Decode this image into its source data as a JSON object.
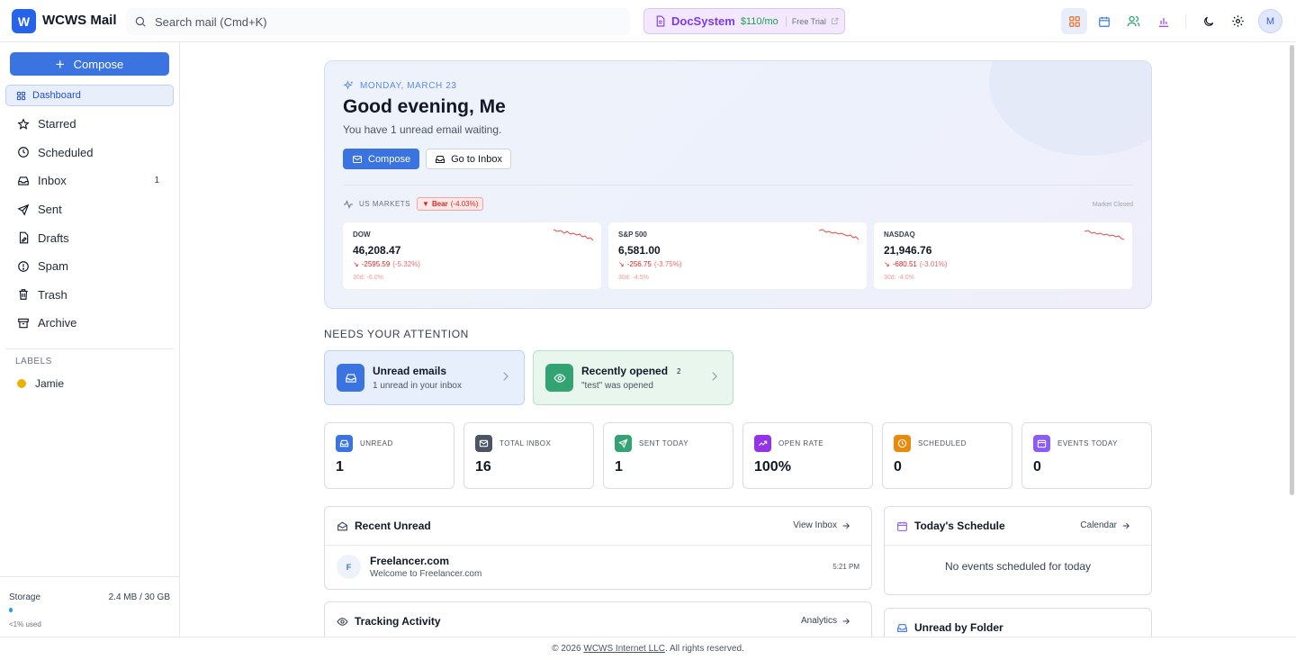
{
  "app": {
    "logo_letter": "W",
    "title": "WCWS Mail"
  },
  "search": {
    "placeholder": "Search mail (Cmd+K)"
  },
  "promo": {
    "name": "DocSystem",
    "price": "$110/mo",
    "trial": "Free Trial"
  },
  "user": {
    "initial": "M"
  },
  "sidebar": {
    "compose_label": "Compose",
    "items": [
      {
        "label": "Dashboard",
        "icon": "grid-icon",
        "active": true
      },
      {
        "label": "Starred",
        "icon": "star-icon"
      },
      {
        "label": "Scheduled",
        "icon": "clock-icon"
      },
      {
        "label": "Inbox",
        "icon": "inbox-icon",
        "count": "1"
      },
      {
        "label": "Sent",
        "icon": "send-icon"
      },
      {
        "label": "Drafts",
        "icon": "draft-icon"
      },
      {
        "label": "Spam",
        "icon": "alert-icon"
      },
      {
        "label": "Trash",
        "icon": "trash-icon"
      },
      {
        "label": "Archive",
        "icon": "archive-icon"
      }
    ],
    "labels_title": "LABELS",
    "labels": [
      {
        "name": "Jamie",
        "color": "#eab308"
      }
    ],
    "storage": {
      "label": "Storage",
      "value": "2.4 MB / 30 GB",
      "used_text": "<1% used",
      "used_fraction": 0.01
    }
  },
  "hero": {
    "date": "MONDAY, MARCH 23",
    "greeting": "Good evening, Me",
    "subtitle": "You have 1 unread email waiting.",
    "compose_label": "Compose",
    "inbox_label": "Go to Inbox",
    "markets_label": "US MARKETS",
    "bear_label": "Bear",
    "bear_pct": "(-4.03%)",
    "market_status": "Market Closed",
    "tickers": [
      {
        "name": "DOW",
        "value": "46,208.47",
        "change": "-2595.59",
        "pct": "(-5.32%)",
        "month": "30d: -6.0%"
      },
      {
        "name": "S&P 500",
        "value": "6,581.00",
        "change": "-256.75",
        "pct": "(-3.75%)",
        "month": "30d: -4.5%"
      },
      {
        "name": "NASDAQ",
        "value": "21,946.76",
        "change": "-680.51",
        "pct": "(-3.01%)",
        "month": "30d: -4.0%"
      }
    ]
  },
  "attention": {
    "title": "NEEDS YOUR ATTENTION",
    "unread": {
      "title": "Unread emails",
      "sub": "1 unread in your inbox"
    },
    "opened": {
      "title": "Recently opened",
      "badge": "2",
      "sub": "\"test\" was opened"
    }
  },
  "stats": [
    {
      "label": "UNREAD",
      "value": "1",
      "color": "#3b74e0"
    },
    {
      "label": "TOTAL INBOX",
      "value": "16",
      "color": "#4b5563"
    },
    {
      "label": "SENT TODAY",
      "value": "1",
      "color": "#34a373"
    },
    {
      "label": "OPEN RATE",
      "value": "100%",
      "color": "#9333ea"
    },
    {
      "label": "SCHEDULED",
      "value": "0",
      "color": "#ea8a0c"
    },
    {
      "label": "EVENTS TODAY",
      "value": "0",
      "color": "#8b5cf6"
    }
  ],
  "recent_unread": {
    "title": "Recent Unread",
    "link": "View Inbox",
    "items": [
      {
        "initial": "F",
        "from": "Freelancer.com",
        "subject": "Welcome to Freelancer.com",
        "time": "5:21 PM"
      }
    ]
  },
  "schedule": {
    "title": "Today's Schedule",
    "link": "Calendar",
    "empty": "No events scheduled for today"
  },
  "tracking": {
    "title": "Tracking Activity",
    "link": "Analytics"
  },
  "unread_folder": {
    "title": "Unread by Folder"
  },
  "footer": {
    "prefix": "© 2026 ",
    "company": "WCWS Internet LLC",
    "suffix": ". All rights reserved."
  }
}
